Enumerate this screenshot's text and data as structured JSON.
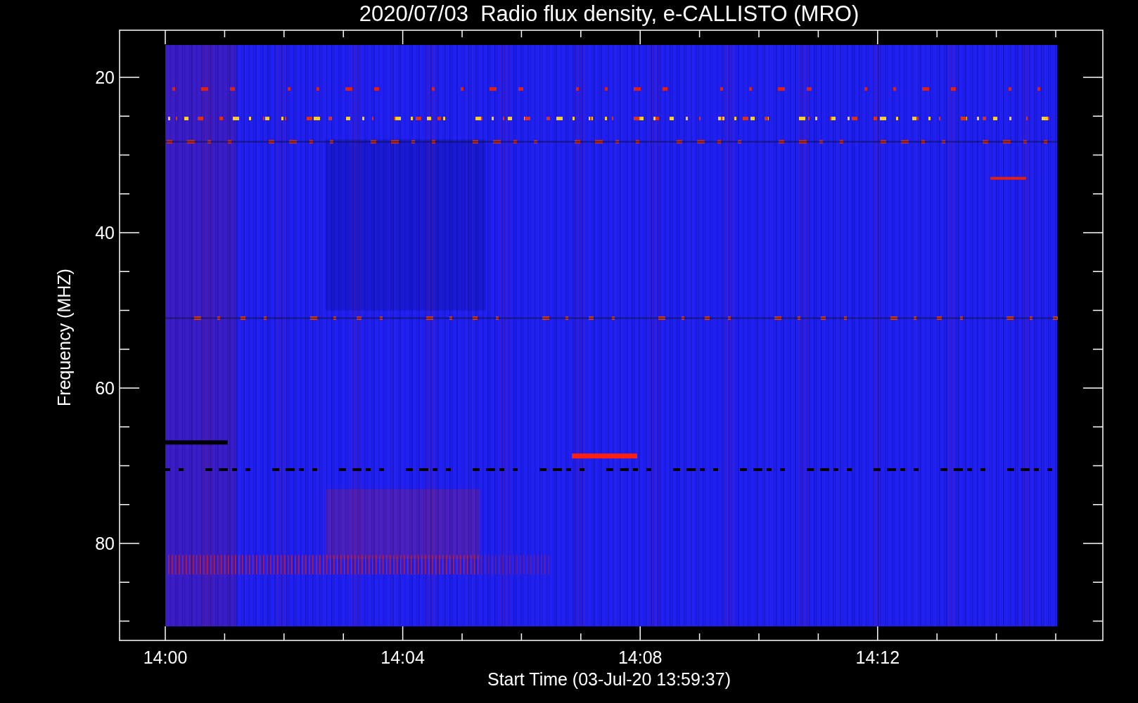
{
  "title": "2020/07/03  Radio flux density, e-CALLISTO (MRO)",
  "plot": {
    "ylabel": "Frequency (MHZ)",
    "xlabel": "Start Time (03-Jul-20 13:59:37)",
    "yticks": [
      "20",
      "40",
      "60",
      "80"
    ],
    "xticks": [
      "14:00",
      "14:04",
      "14:08",
      "14:12"
    ]
  }
}
